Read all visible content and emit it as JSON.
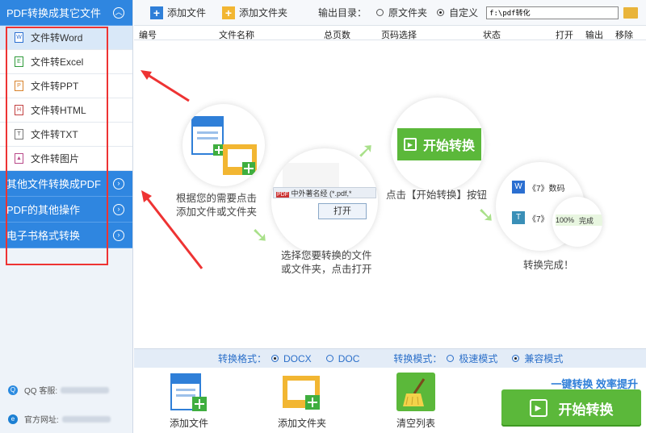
{
  "sidebar": {
    "categories": [
      {
        "label": "PDF转换成其它文件",
        "expanded": true
      },
      {
        "label": "其他文件转换成PDF",
        "expanded": false
      },
      {
        "label": "PDF的其他操作",
        "expanded": false
      },
      {
        "label": "电子书格式转换",
        "expanded": false
      }
    ],
    "items": [
      {
        "label": "文件转Word",
        "icon": "word-file-icon",
        "active": true
      },
      {
        "label": "文件转Excel",
        "icon": "excel-file-icon",
        "active": false
      },
      {
        "label": "文件转PPT",
        "icon": "ppt-file-icon",
        "active": false
      },
      {
        "label": "文件转HTML",
        "icon": "html-file-icon",
        "active": false
      },
      {
        "label": "文件转TXT",
        "icon": "txt-file-icon",
        "active": false
      },
      {
        "label": "文件转图片",
        "icon": "image-file-icon",
        "active": false
      }
    ],
    "qq_label": "QQ 客服:",
    "website_label": "官方网址:"
  },
  "toolbar": {
    "add_file": "添加文件",
    "add_folder": "添加文件夹",
    "output_dir_label": "输出目录：",
    "option_source": "原文件夹",
    "option_custom": "自定义",
    "selected": "custom",
    "path_value": "f:\\pdf转化"
  },
  "table": {
    "headers": [
      "编号",
      "文件名称",
      "总页数",
      "页码选择",
      "状态",
      "打开",
      "输出",
      "移除"
    ]
  },
  "guide": {
    "step1": "根据您的需要点击添加文件或文件夹",
    "step1_line1": "根据您的需要点击",
    "step1_line2": "添加文件或文件夹",
    "step2_line1": "选择您要转换的文件",
    "step2_line2": "或文件夹，点击打开",
    "step2_open": "打开",
    "step2_snippet": "中外著名经",
    "step2_ext": "(*.pdf,*",
    "step3": "点击【开始转换】按钮",
    "step3_btn": "开始转换",
    "step4": "转换完成！",
    "step4_row1": "《7》数码",
    "step4_row2": "《7》",
    "step4_progress": "100%",
    "step4_done": "完成"
  },
  "options": {
    "format_label": "转换格式：",
    "format_docx": "DOCX",
    "format_doc": "DOC",
    "format_selected": "DOCX",
    "mode_label": "转换模式：",
    "mode_fast": "极速模式",
    "mode_compat": "兼容模式",
    "mode_selected": "兼容模式"
  },
  "bottom": {
    "add_file": "添加文件",
    "add_folder": "添加文件夹",
    "clear_list": "清空列表",
    "slogan": "一键转换  效率提升",
    "start": "开始转换"
  },
  "colors": {
    "sidebar_blue": "#2f86e0",
    "start_green": "#5bb83a",
    "annotation_red": "#e33",
    "option_blue": "#2b6fc9"
  }
}
